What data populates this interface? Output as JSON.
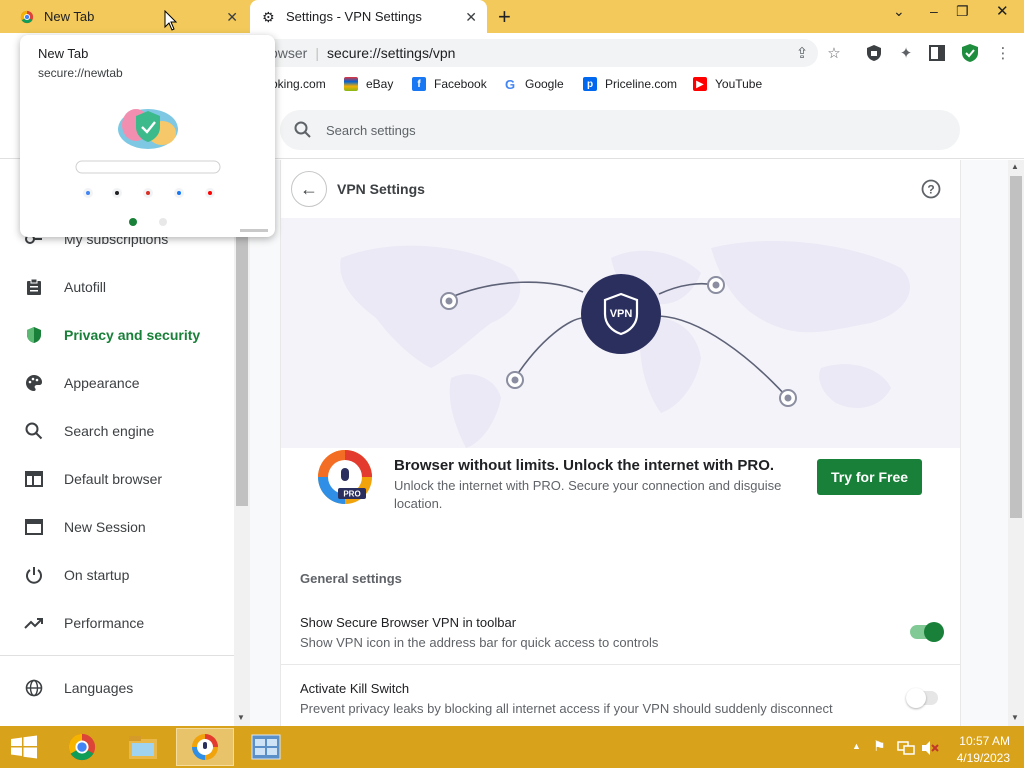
{
  "browser": {
    "tabs": [
      {
        "label": "New Tab"
      },
      {
        "label": "Settings - VPN Settings"
      }
    ],
    "address": {
      "scheme_hint": "owser",
      "url": "secure://settings/vpn"
    },
    "bookmarks": [
      {
        "label": "oking.com"
      },
      {
        "label": "eBay"
      },
      {
        "label": "Facebook"
      },
      {
        "label": "Google"
      },
      {
        "label": "Priceline.com"
      },
      {
        "label": "YouTube"
      }
    ]
  },
  "hovercard": {
    "title": "New Tab",
    "url": "secure://newtab"
  },
  "settings": {
    "search_placeholder": "Search settings",
    "sidebar": [
      {
        "label": "My subscriptions",
        "icon": "key-icon"
      },
      {
        "label": "Autofill",
        "icon": "clipboard-icon"
      },
      {
        "label": "Privacy and security",
        "icon": "shield-icon",
        "active": true
      },
      {
        "label": "Appearance",
        "icon": "palette-icon"
      },
      {
        "label": "Search engine",
        "icon": "search-icon"
      },
      {
        "label": "Default browser",
        "icon": "browser-icon"
      },
      {
        "label": "New Session",
        "icon": "window-icon"
      },
      {
        "label": "On startup",
        "icon": "power-icon"
      },
      {
        "label": "Performance",
        "icon": "trend-icon"
      },
      {
        "label": "Languages",
        "icon": "globe-icon"
      }
    ],
    "page_title": "VPN Settings",
    "vpn_badge": "VPN",
    "promo": {
      "badge": "PRO",
      "title": "Browser without limits. Unlock the internet with PRO.",
      "description": "Unlock the internet with PRO. Secure your connection and disguise location.",
      "button": "Try for Free"
    },
    "general_label": "General settings",
    "rows": [
      {
        "title": "Show Secure Browser VPN in toolbar",
        "subtitle": "Show VPN icon in the address bar for quick access to controls",
        "enabled": true
      },
      {
        "title": "Activate Kill Switch",
        "subtitle": "Prevent privacy leaks by blocking all internet access if your VPN should suddenly disconnect",
        "enabled": false
      }
    ]
  },
  "taskbar": {
    "time": "10:57 AM",
    "date": "4/19/2023"
  },
  "colors": {
    "accent": "#188038",
    "tabstrip": "#f2c95a",
    "taskbar": "#d9a21b",
    "vpn_badge": "#2b2f5e"
  }
}
